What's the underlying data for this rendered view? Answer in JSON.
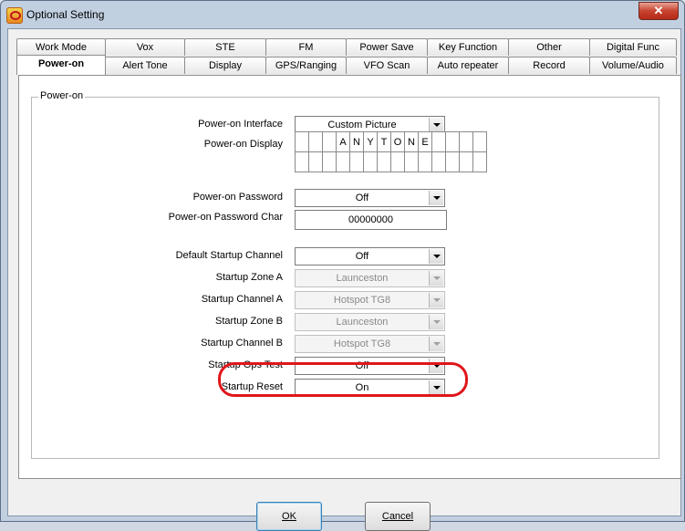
{
  "window": {
    "title": "Optional Setting",
    "close_label": "✕"
  },
  "tabs_row1": [
    "Work Mode",
    "Vox",
    "STE",
    "FM",
    "Power Save",
    "Key Function",
    "Other",
    "Digital Func"
  ],
  "tabs_row2": [
    "Power-on",
    "Alert Tone",
    "Display",
    "GPS/Ranging",
    "VFO Scan",
    "Auto repeater",
    "Record",
    "Volume/Audio"
  ],
  "active_tab": "Power-on",
  "group": {
    "title": "Power-on"
  },
  "fields": {
    "poweron_interface": {
      "label": "Power-on Interface",
      "value": "Custom Picture"
    },
    "poweron_display": {
      "label": "Power-on Display",
      "row1": [
        "",
        "",
        "",
        "A",
        "N",
        "Y",
        "T",
        "O",
        "N",
        "E",
        "",
        "",
        "",
        ""
      ],
      "row2": [
        "",
        "",
        "",
        "",
        "",
        "",
        "",
        "",
        "",
        "",
        "",
        "",
        "",
        ""
      ]
    },
    "poweron_password": {
      "label": "Power-on Password",
      "value": "Off"
    },
    "poweron_password_char": {
      "label": "Power-on Password Char",
      "value": "00000000"
    },
    "default_startup_channel": {
      "label": "Default Startup Channel",
      "value": "Off"
    },
    "startup_zone_a": {
      "label": "Startup Zone A",
      "value": "Launceston"
    },
    "startup_channel_a": {
      "label": "Startup Channel A",
      "value": "Hotspot TG8"
    },
    "startup_zone_b": {
      "label": "Startup Zone B",
      "value": "Launceston"
    },
    "startup_channel_b": {
      "label": "Startup Channel B",
      "value": "Hotspot TG8"
    },
    "startup_gps_test": {
      "label": "Startup Gps Test",
      "value": "Off"
    },
    "startup_reset": {
      "label": "Startup Reset",
      "value": "On"
    }
  },
  "buttons": {
    "ok_label": "OK",
    "cancel_label": "Cancel"
  },
  "colors": {
    "highlight": "#e0161b",
    "window_frame": "#bccde0"
  }
}
